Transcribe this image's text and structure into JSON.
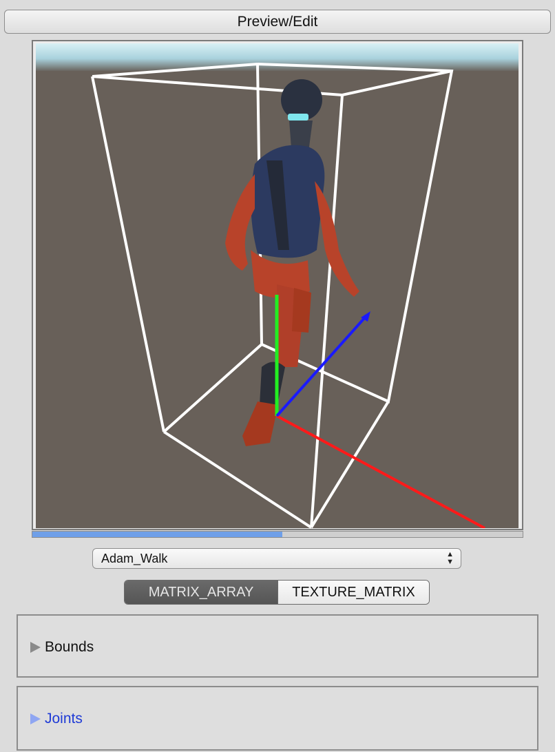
{
  "header": {
    "preview_label": "Preview/Edit"
  },
  "viewport": {
    "sky_color": "#a9d7e3",
    "ground_color": "#686059",
    "axis_colors": {
      "x": "#ff1a1a",
      "y": "#22ee22",
      "z": "#1a1aff"
    },
    "bounds_color": "#ffffff"
  },
  "playback": {
    "progress": 0.51
  },
  "animation_select": {
    "selected": "Adam_Walk"
  },
  "mode_toggle": {
    "options": [
      "MATRIX_ARRAY",
      "TEXTURE_MATRIX"
    ],
    "active": "MATRIX_ARRAY"
  },
  "sections": {
    "bounds": {
      "label": "Bounds"
    },
    "joints": {
      "label": "Joints",
      "color": "#1f3bd6"
    }
  }
}
